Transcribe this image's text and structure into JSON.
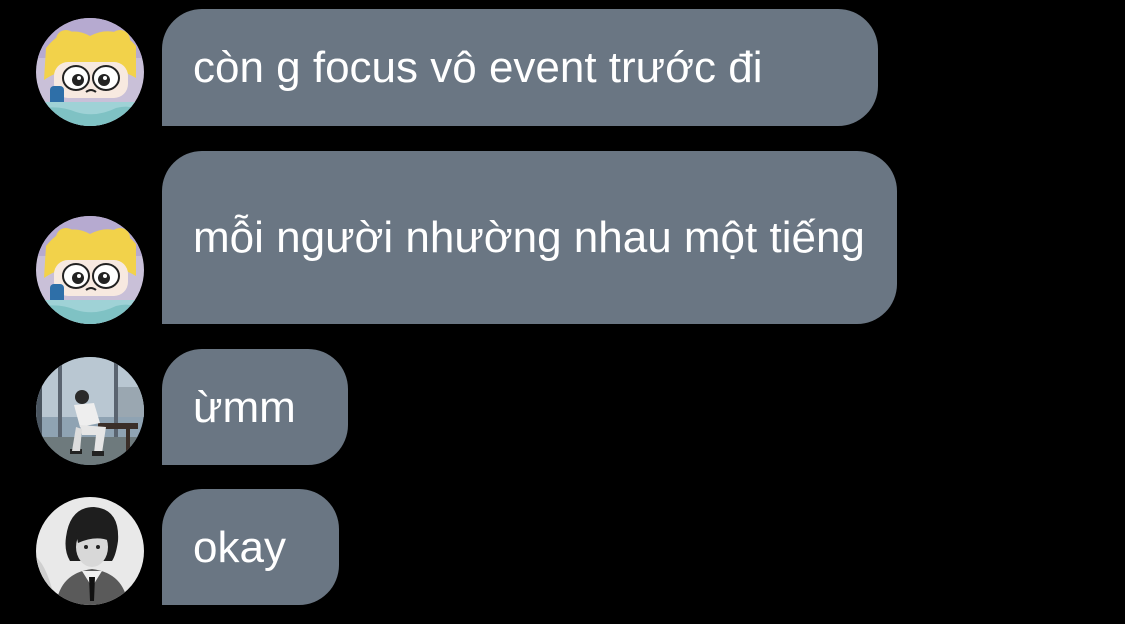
{
  "messages": [
    {
      "text": "còn g focus vô event trước đi",
      "avatar": "cartoon-girl-avatar-icon"
    },
    {
      "text": "mỗi người nhường nhau một tiếng",
      "avatar": "cartoon-girl-avatar-icon"
    },
    {
      "text": "ừmm",
      "avatar": "photo-man-sitting-avatar-icon"
    },
    {
      "text": "okay",
      "avatar": "bw-portrait-avatar-icon"
    }
  ],
  "colors": {
    "background": "#000000",
    "bubble": "#6a7683",
    "text": "#ffffff"
  }
}
